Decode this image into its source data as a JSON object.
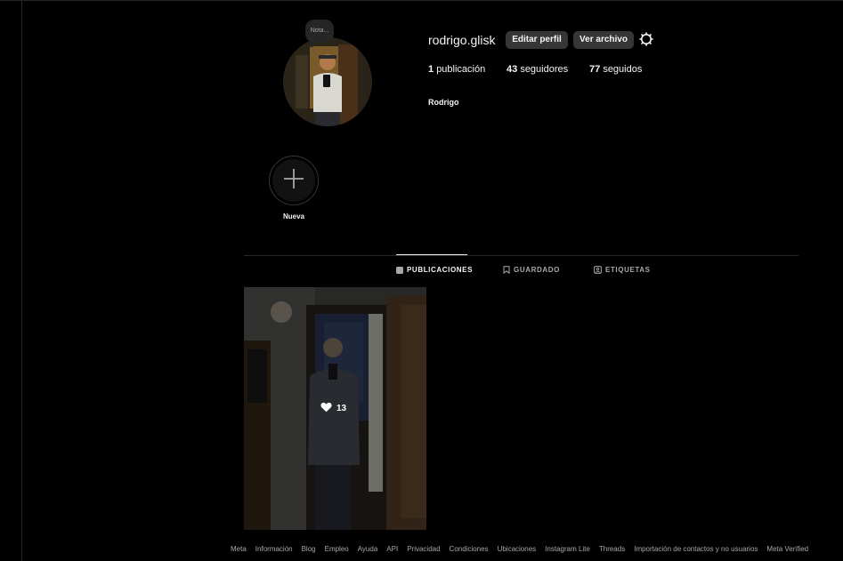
{
  "profile": {
    "username": "rodrigo.glisk",
    "full_name": "Rodrigo",
    "note_placeholder": "Nota...",
    "edit_profile_label": "Editar perfil",
    "view_archive_label": "Ver archivo",
    "stats": {
      "posts_count": "1",
      "posts_label": "publicación",
      "followers_count": "43",
      "followers_label": "seguidores",
      "following_count": "77",
      "following_label": "seguidos"
    }
  },
  "highlights": {
    "new_label": "Nueva",
    "new_icon": "plus-icon"
  },
  "tabs": [
    {
      "label": "PUBLICACIONES",
      "icon": "grid-icon",
      "active": true
    },
    {
      "label": "GUARDADO",
      "icon": "bookmark-icon",
      "active": false
    },
    {
      "label": "ETIQUETAS",
      "icon": "tag-icon",
      "active": false
    }
  ],
  "posts": [
    {
      "likes": "13",
      "icon": "heart-icon"
    }
  ],
  "footer": {
    "links": [
      "Meta",
      "Información",
      "Blog",
      "Empleo",
      "Ayuda",
      "API",
      "Privacidad",
      "Condiciones",
      "Ubicaciones",
      "Instagram Lite",
      "Threads",
      "Importación de contactos y no usuarios",
      "Meta Verified"
    ]
  },
  "colors": {
    "background": "#000000",
    "button": "#363636",
    "text_primary": "#f5f5f5",
    "text_secondary": "#a8a8a8",
    "divider": "#262626"
  }
}
